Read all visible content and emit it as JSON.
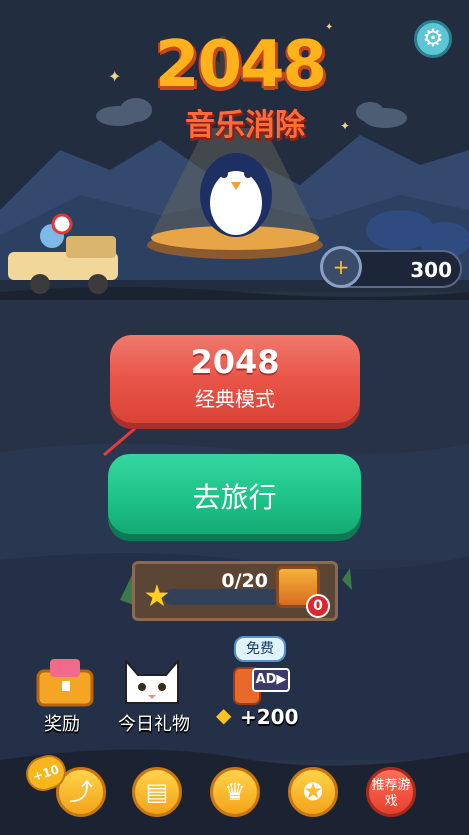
{
  "title": {
    "logo_number": "2048",
    "logo_subtitle": "音乐消除"
  },
  "header": {
    "settings_icon": "gear-icon"
  },
  "balance": {
    "coins": "300",
    "icon": "banana-coin-icon"
  },
  "modes": {
    "classic": {
      "number": "2048",
      "label": "经典模式"
    },
    "travel": {
      "label": "去旅行"
    }
  },
  "progress": {
    "text": "0/20",
    "current": 0,
    "total": 20,
    "chest_badge": "0"
  },
  "features": {
    "reward": {
      "label": "奖励"
    },
    "daily_gift": {
      "label": "今日礼物"
    },
    "free_ad": {
      "tag": "免费",
      "ad_label": "AD▶",
      "coin_reward": "+200"
    }
  },
  "bottom_nav": {
    "share_bonus": "+10",
    "recommend_label": "推荐游戏",
    "icons": [
      "share-icon",
      "book-icon",
      "crown-icon",
      "medal-icon",
      "recommend-icon"
    ]
  },
  "colors": {
    "classic_button": "#e95548",
    "travel_button": "#1ec388",
    "nav_button": "#ffc52e",
    "logo": "#ffb21a"
  }
}
